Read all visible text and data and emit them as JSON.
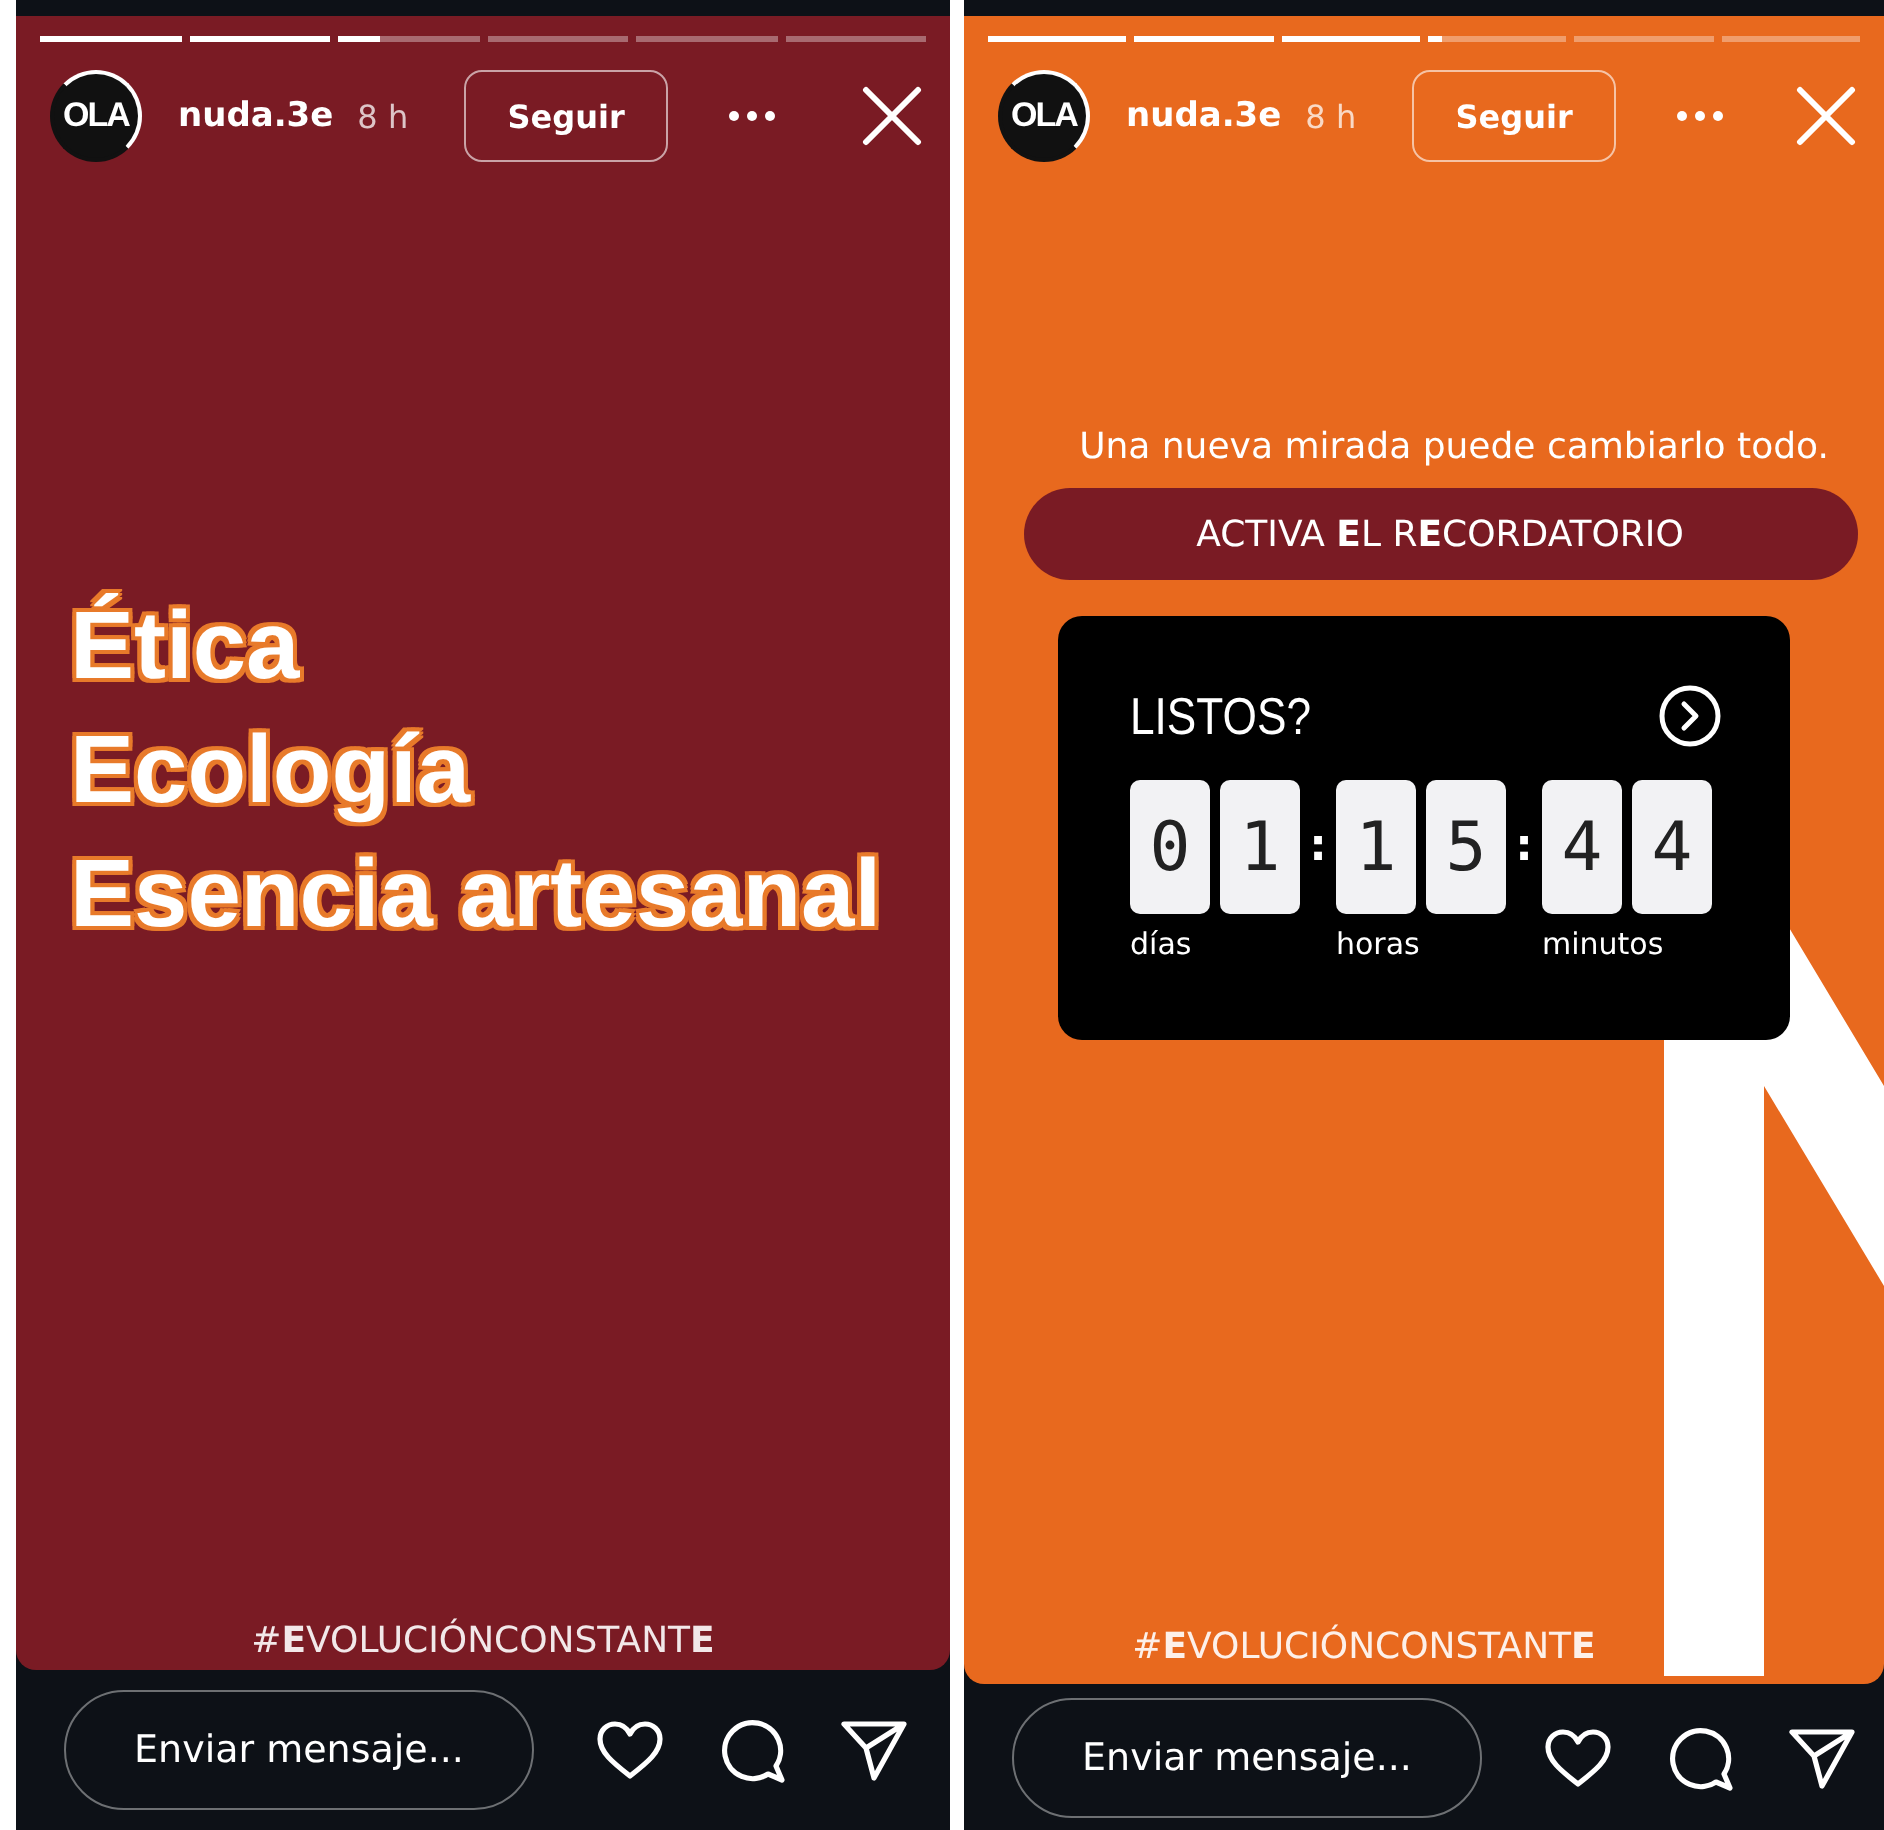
{
  "stories": [
    {
      "color": "#7a1b24",
      "progress": [
        {
          "level": 1
        },
        {
          "level": 1
        },
        {
          "level": 0.3
        },
        {
          "level": 0
        },
        {
          "level": 0
        },
        {
          "level": 0
        }
      ],
      "avatar": "OLA",
      "username": "nuda.3e",
      "time": "8 h",
      "follow_button": "Seguir",
      "content": {
        "kind": "headline",
        "lines": [
          "Ética",
          "Ecología",
          "Esencia artesanal"
        ]
      },
      "hashtag": "#**E**VOLUCIÓNCONSTANT**E**",
      "message_placeholder": "Enviar mensaje..."
    },
    {
      "color": "#e8691e",
      "progress": [
        {
          "level": 1
        },
        {
          "level": 1
        },
        {
          "level": 1
        },
        {
          "level": 0.1
        },
        {
          "level": 0
        },
        {
          "level": 0
        }
      ],
      "avatar": "OLA",
      "username": "nuda.3e",
      "time": "8 h",
      "follow_button": "Seguir",
      "content": {
        "kind": "countdown",
        "caption": "Una nueva mirada puede cambiarlo todo.",
        "button": "ACTIVA **E**L R**E**CORDATORIO",
        "title": "LISTOS?",
        "separator": ":",
        "groups": [
          {
            "digits": [
              "0",
              "1"
            ],
            "label": "días"
          },
          {
            "digits": [
              "1",
              "5"
            ],
            "label": "horas"
          },
          {
            "digits": [
              "4",
              "4"
            ],
            "label": "minutos"
          }
        ]
      },
      "hashtag": "#**E**VOLUCIÓNCONSTANT**E**",
      "message_placeholder": "Enviar mensaje..."
    }
  ]
}
